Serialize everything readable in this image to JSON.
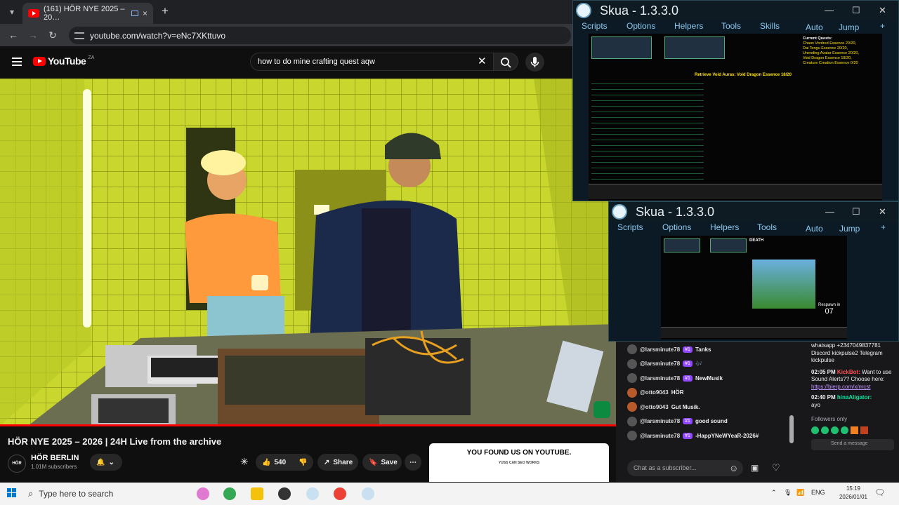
{
  "browser": {
    "tab": {
      "title": "(161) HÖR NYE 2025 – 20…",
      "close": "×"
    },
    "new_tab": "+",
    "url": "youtube.com/watch?v=eNc7XKttuvo"
  },
  "youtube": {
    "logo_text": "YouTube",
    "country_code": "ZA",
    "search_query": "how to do mine crafting quest aqw",
    "video_title": "HÖR NYE 2025 – 2026 | 24H Live from the archive",
    "channel": {
      "avatar_text": "HÖR",
      "name": "HÖR BERLIN",
      "subscribers": "1.01M subscribers"
    },
    "actions": {
      "likes": "540",
      "share": "Share",
      "save": "Save",
      "more": "⋯"
    },
    "promo": {
      "title": "YOU FOUND US ON YOUTUBE.",
      "subtitle": "YUSS CAN SEO WORKS"
    }
  },
  "skua_windows": [
    {
      "title": "Skua - 1.3.3.0",
      "menu": [
        "Scripts",
        "Options",
        "Helpers",
        "Tools",
        "Skills"
      ],
      "right_menu": [
        "Auto",
        "Jump",
        "+"
      ],
      "quest_header": "Retrieve Void Auras: Void Dragon Essence 18/20",
      "quest_list_title": "Current Quests:",
      "quests": [
        "Chaos Vordred Essence 20/20,",
        "Dai Tengu Essence 20/20,",
        "Unending Avatar Essence 20/20,",
        "Void Dragon Essence 18/20,",
        "Creature Creation Essence 0/20"
      ]
    },
    {
      "title": "Skua - 1.3.3.0",
      "menu": [
        "Scripts",
        "Options",
        "Helpers",
        "Tools"
      ],
      "right_menu": [
        "Auto",
        "Jump",
        "+"
      ],
      "death_text": "DEATH",
      "respawn_label": "Respawn in",
      "respawn_count": "07"
    }
  ],
  "chat": {
    "lines": [
      {
        "user": "@larsminute78",
        "badge": "#1",
        "msg": "Tanks"
      },
      {
        "user": "@larsminute78",
        "badge": "#1",
        "msg": "🎶"
      },
      {
        "user": "@larsminute78",
        "badge": "#1",
        "msg": "NewMusik"
      },
      {
        "user": "@otto9043",
        "badge": "",
        "msg": "HÖR"
      },
      {
        "user": "@otto9043",
        "badge": "",
        "msg": "Gut Musik."
      },
      {
        "user": "@larsminute78",
        "badge": "#1",
        "msg": "good sound"
      },
      {
        "user": "@larsminute78",
        "badge": "#1",
        "msg": "-HappYNeWYeaR-2026#"
      }
    ],
    "input_placeholder": "Chat as a subscriber...",
    "side": {
      "top_text": "whatsapp +2347049837781 Discord kickpulse2 Telegram kickpulse",
      "msg1_time": "02:05 PM",
      "msg1_user": "KickBot:",
      "msg1_text": "Want to use Sound Alerts?? Choose here:",
      "msg1_link": "https://bierp.com/x/mcst",
      "msg2_time": "02:40 PM",
      "msg2_user": "hinaAligator:",
      "msg2_text": "ayo",
      "followers_only": "Followers only",
      "send_placeholder": "Send a message"
    }
  },
  "taskbar": {
    "search_placeholder": "Type here to search",
    "lang": "ENG",
    "time": "15:19",
    "date": "2026/01/01"
  }
}
